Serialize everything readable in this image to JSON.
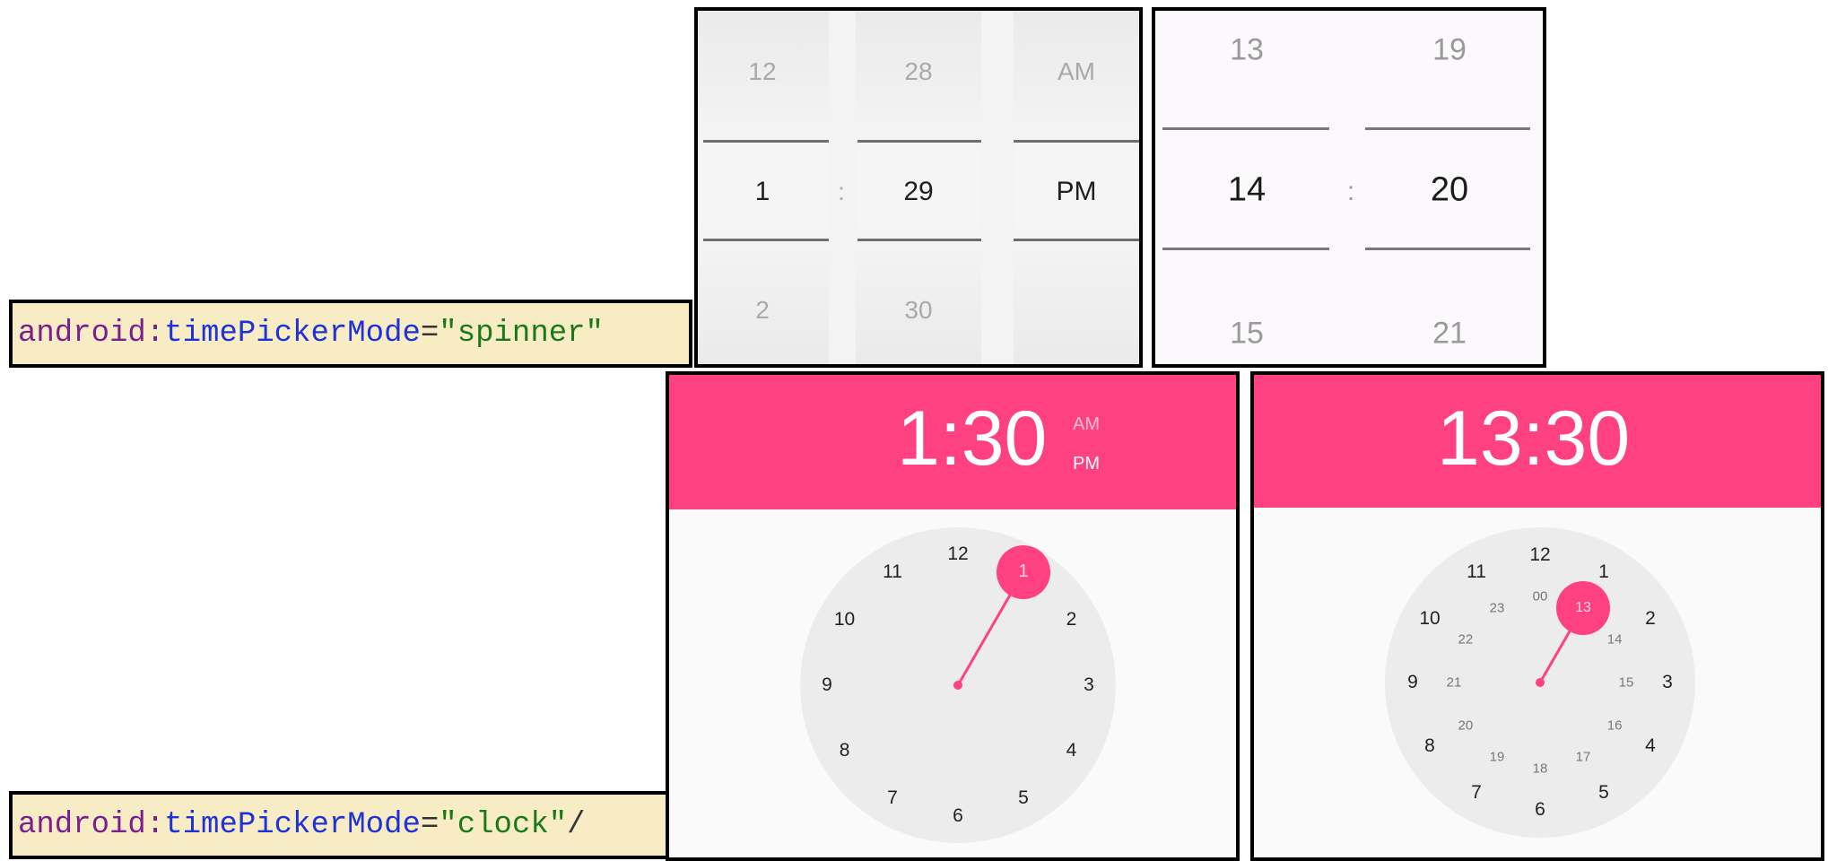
{
  "labels": {
    "spinner": {
      "prefix": "android:",
      "key": "timePickerMode",
      "eq": "=",
      "value": "\"spinner\"",
      "suffix": ""
    },
    "clock": {
      "prefix": "android:",
      "key": "timePickerMode",
      "eq": "=",
      "value": "\"clock\"",
      "suffix": "/"
    }
  },
  "spinner12": {
    "hour": {
      "prev": "12",
      "current": "1",
      "next": "2"
    },
    "separator": ":",
    "minute": {
      "prev": "28",
      "current": "29",
      "next": "30"
    },
    "ampm": {
      "prev": "AM",
      "current": "PM"
    }
  },
  "spinner24": {
    "hour": {
      "prev": "13",
      "current": "14",
      "next": "15"
    },
    "separator": ":",
    "minute": {
      "prev": "19",
      "current": "20",
      "next": "21"
    }
  },
  "clock12": {
    "time": "1:30",
    "am": "AM",
    "pm": "PM",
    "selected": "1",
    "numbers": [
      "12",
      "1",
      "2",
      "3",
      "4",
      "5",
      "6",
      "7",
      "8",
      "9",
      "10",
      "11"
    ],
    "accent": "#ff4081"
  },
  "clock24": {
    "time": "13:30",
    "selected": "13",
    "outer": [
      "12",
      "1",
      "2",
      "3",
      "4",
      "5",
      "6",
      "7",
      "8",
      "9",
      "10",
      "11"
    ],
    "inner": [
      "00",
      "13",
      "14",
      "15",
      "16",
      "17",
      "18",
      "19",
      "20",
      "21",
      "22",
      "23"
    ],
    "accent": "#ff4081"
  }
}
